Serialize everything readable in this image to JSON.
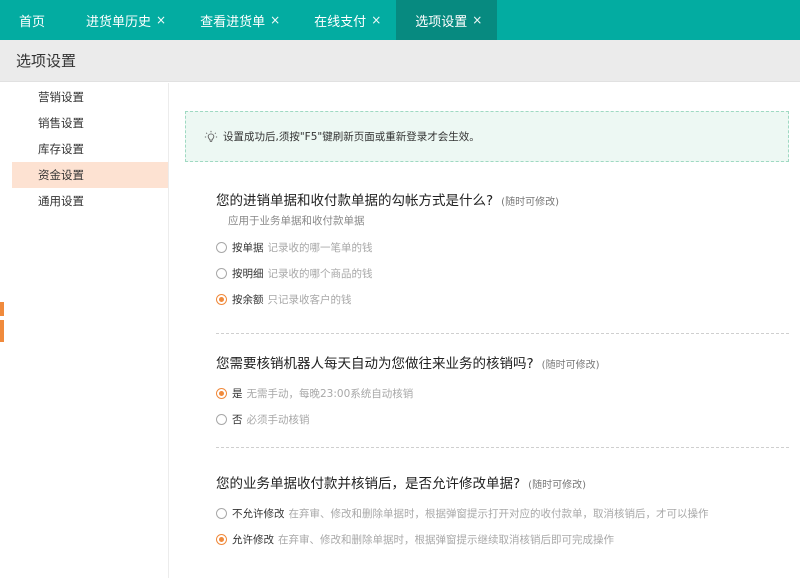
{
  "tabs": [
    {
      "label": "首页",
      "closable": false,
      "active": false
    },
    {
      "label": "进货单历史",
      "closable": true,
      "active": false
    },
    {
      "label": "查看进货单",
      "closable": true,
      "active": false
    },
    {
      "label": "在线支付",
      "closable": true,
      "active": false
    },
    {
      "label": "选项设置",
      "closable": true,
      "active": true
    }
  ],
  "close_glyph": "×",
  "page_title": "选项设置",
  "sidebar": {
    "items": [
      {
        "label": "营销设置"
      },
      {
        "label": "销售设置"
      },
      {
        "label": "库存设置"
      },
      {
        "label": "资金设置",
        "active": true
      },
      {
        "label": "通用设置"
      }
    ]
  },
  "notice": {
    "icon": "lightbulb-icon",
    "text": "设置成功后,须按\"F5\"键刷新页面或重新登录才会生效。"
  },
  "questions": [
    {
      "title": "您的进销单据和收付款单据的勾帐方式是什么?",
      "hint": "(随时可修改)",
      "subtitle": "应用于业务单据和收付款单据",
      "options": [
        {
          "label": "按单据",
          "desc": "记录收的哪一笔单的钱",
          "selected": false
        },
        {
          "label": "按明细",
          "desc": "记录收的哪个商品的钱",
          "selected": false
        },
        {
          "label": "按余额",
          "desc": "只记录收客户的钱",
          "selected": true
        }
      ]
    },
    {
      "title": "您需要核销机器人每天自动为您做往来业务的核销吗?",
      "hint": "(随时可修改)",
      "options": [
        {
          "label": "是",
          "desc": "无需手动，每晚23:00系统自动核销",
          "selected": true
        },
        {
          "label": "否",
          "desc": "必须手动核销",
          "selected": false
        }
      ]
    },
    {
      "title": "您的业务单据收付款并核销后，是否允许修改单据?",
      "hint": "(随时可修改)",
      "options": [
        {
          "label": "不允许修改",
          "desc": "在弃审、修改和删除单据时，根据弹窗提示打开对应的收付款单，取消核销后，才可以操作",
          "selected": false
        },
        {
          "label": "允许修改",
          "desc": "在弃审、修改和删除单据时，根据弹窗提示继续取消核销后即可完成操作",
          "selected": true
        }
      ]
    }
  ],
  "colors": {
    "topbar": "#03aca1",
    "active_tab": "#078a80",
    "sidebar_active": "#fde2d2",
    "radio_on": "#f08a3c",
    "notice_bg": "#edf8f3"
  }
}
